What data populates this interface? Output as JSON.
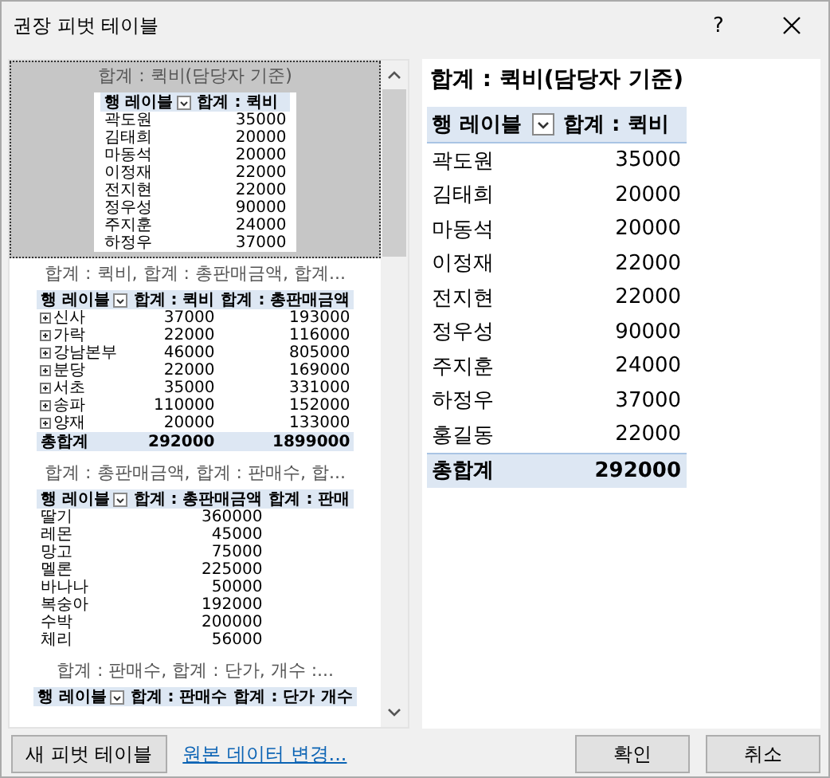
{
  "window": {
    "title": "권장 피벗 테이블",
    "help": "?"
  },
  "recommendations": [
    {
      "title": "합계 : 퀵비(담당자 기준)",
      "selected": true,
      "table": {
        "columns": [
          "행 레이블",
          "합계 : 퀵비"
        ],
        "rows": [
          {
            "cells": [
              "곽도원",
              "35000"
            ]
          },
          {
            "cells": [
              "김태희",
              "20000"
            ]
          },
          {
            "cells": [
              "마동석",
              "20000"
            ]
          },
          {
            "cells": [
              "이정재",
              "22000"
            ]
          },
          {
            "cells": [
              "전지현",
              "22000"
            ]
          },
          {
            "cells": [
              "정우성",
              "90000"
            ]
          },
          {
            "cells": [
              "주지훈",
              "24000"
            ]
          },
          {
            "cells": [
              "하정우",
              "37000"
            ]
          }
        ]
      }
    },
    {
      "title": "합계 : 퀵비, 합계 : 총판매금액, 합계...",
      "selected": false,
      "table": {
        "expandable": true,
        "columns": [
          "행 레이블",
          "합계 : 퀵비",
          "합계 : 총판매금액"
        ],
        "rows": [
          {
            "cells": [
              "신사",
              "37000",
              "193000"
            ]
          },
          {
            "cells": [
              "가락",
              "22000",
              "116000"
            ]
          },
          {
            "cells": [
              "강남본부",
              "46000",
              "805000"
            ]
          },
          {
            "cells": [
              "분당",
              "22000",
              "169000"
            ]
          },
          {
            "cells": [
              "서초",
              "35000",
              "331000"
            ]
          },
          {
            "cells": [
              "송파",
              "110000",
              "152000"
            ]
          },
          {
            "cells": [
              "양재",
              "20000",
              "133000"
            ]
          }
        ],
        "total": [
          "총합계",
          "292000",
          "1899000"
        ]
      }
    },
    {
      "title": "합계 : 총판매금액, 합계 : 판매수, 합...",
      "selected": false,
      "table": {
        "columns": [
          "행 레이블",
          "합계 : 총판매금액",
          "합계 : 판매"
        ],
        "rows": [
          {
            "cells": [
              "딸기",
              "360000"
            ]
          },
          {
            "cells": [
              "레몬",
              "45000"
            ]
          },
          {
            "cells": [
              "망고",
              "75000"
            ]
          },
          {
            "cells": [
              "멜론",
              "225000"
            ]
          },
          {
            "cells": [
              "바나나",
              "50000"
            ]
          },
          {
            "cells": [
              "복숭아",
              "192000"
            ]
          },
          {
            "cells": [
              "수박",
              "200000"
            ]
          },
          {
            "cells": [
              "체리",
              "56000"
            ]
          }
        ]
      }
    },
    {
      "title": "합계 : 판매수, 합계 : 단가, 개수 :...",
      "selected": false,
      "table": {
        "columns": [
          "행 레이블",
          "합계 : 판매수",
          "합계 : 단가",
          "개수"
        ]
      }
    }
  ],
  "preview": {
    "title": "합계 : 퀵비(담당자 기준)",
    "columns": [
      "행 레이블",
      "합계 : 퀵비"
    ],
    "rows": [
      {
        "label": "곽도원",
        "value": "35000"
      },
      {
        "label": "김태희",
        "value": "20000"
      },
      {
        "label": "마동석",
        "value": "20000"
      },
      {
        "label": "이정재",
        "value": "22000"
      },
      {
        "label": "전지현",
        "value": "22000"
      },
      {
        "label": "정우성",
        "value": "90000"
      },
      {
        "label": "주지훈",
        "value": "24000"
      },
      {
        "label": "하정우",
        "value": "37000"
      },
      {
        "label": "홍길동",
        "value": "22000"
      }
    ],
    "total": {
      "label": "총합계",
      "value": "292000"
    }
  },
  "footer": {
    "new_button": "새 피벗 테이블",
    "link": "원본 데이터 변경...",
    "ok": "확인",
    "cancel": "취소"
  }
}
